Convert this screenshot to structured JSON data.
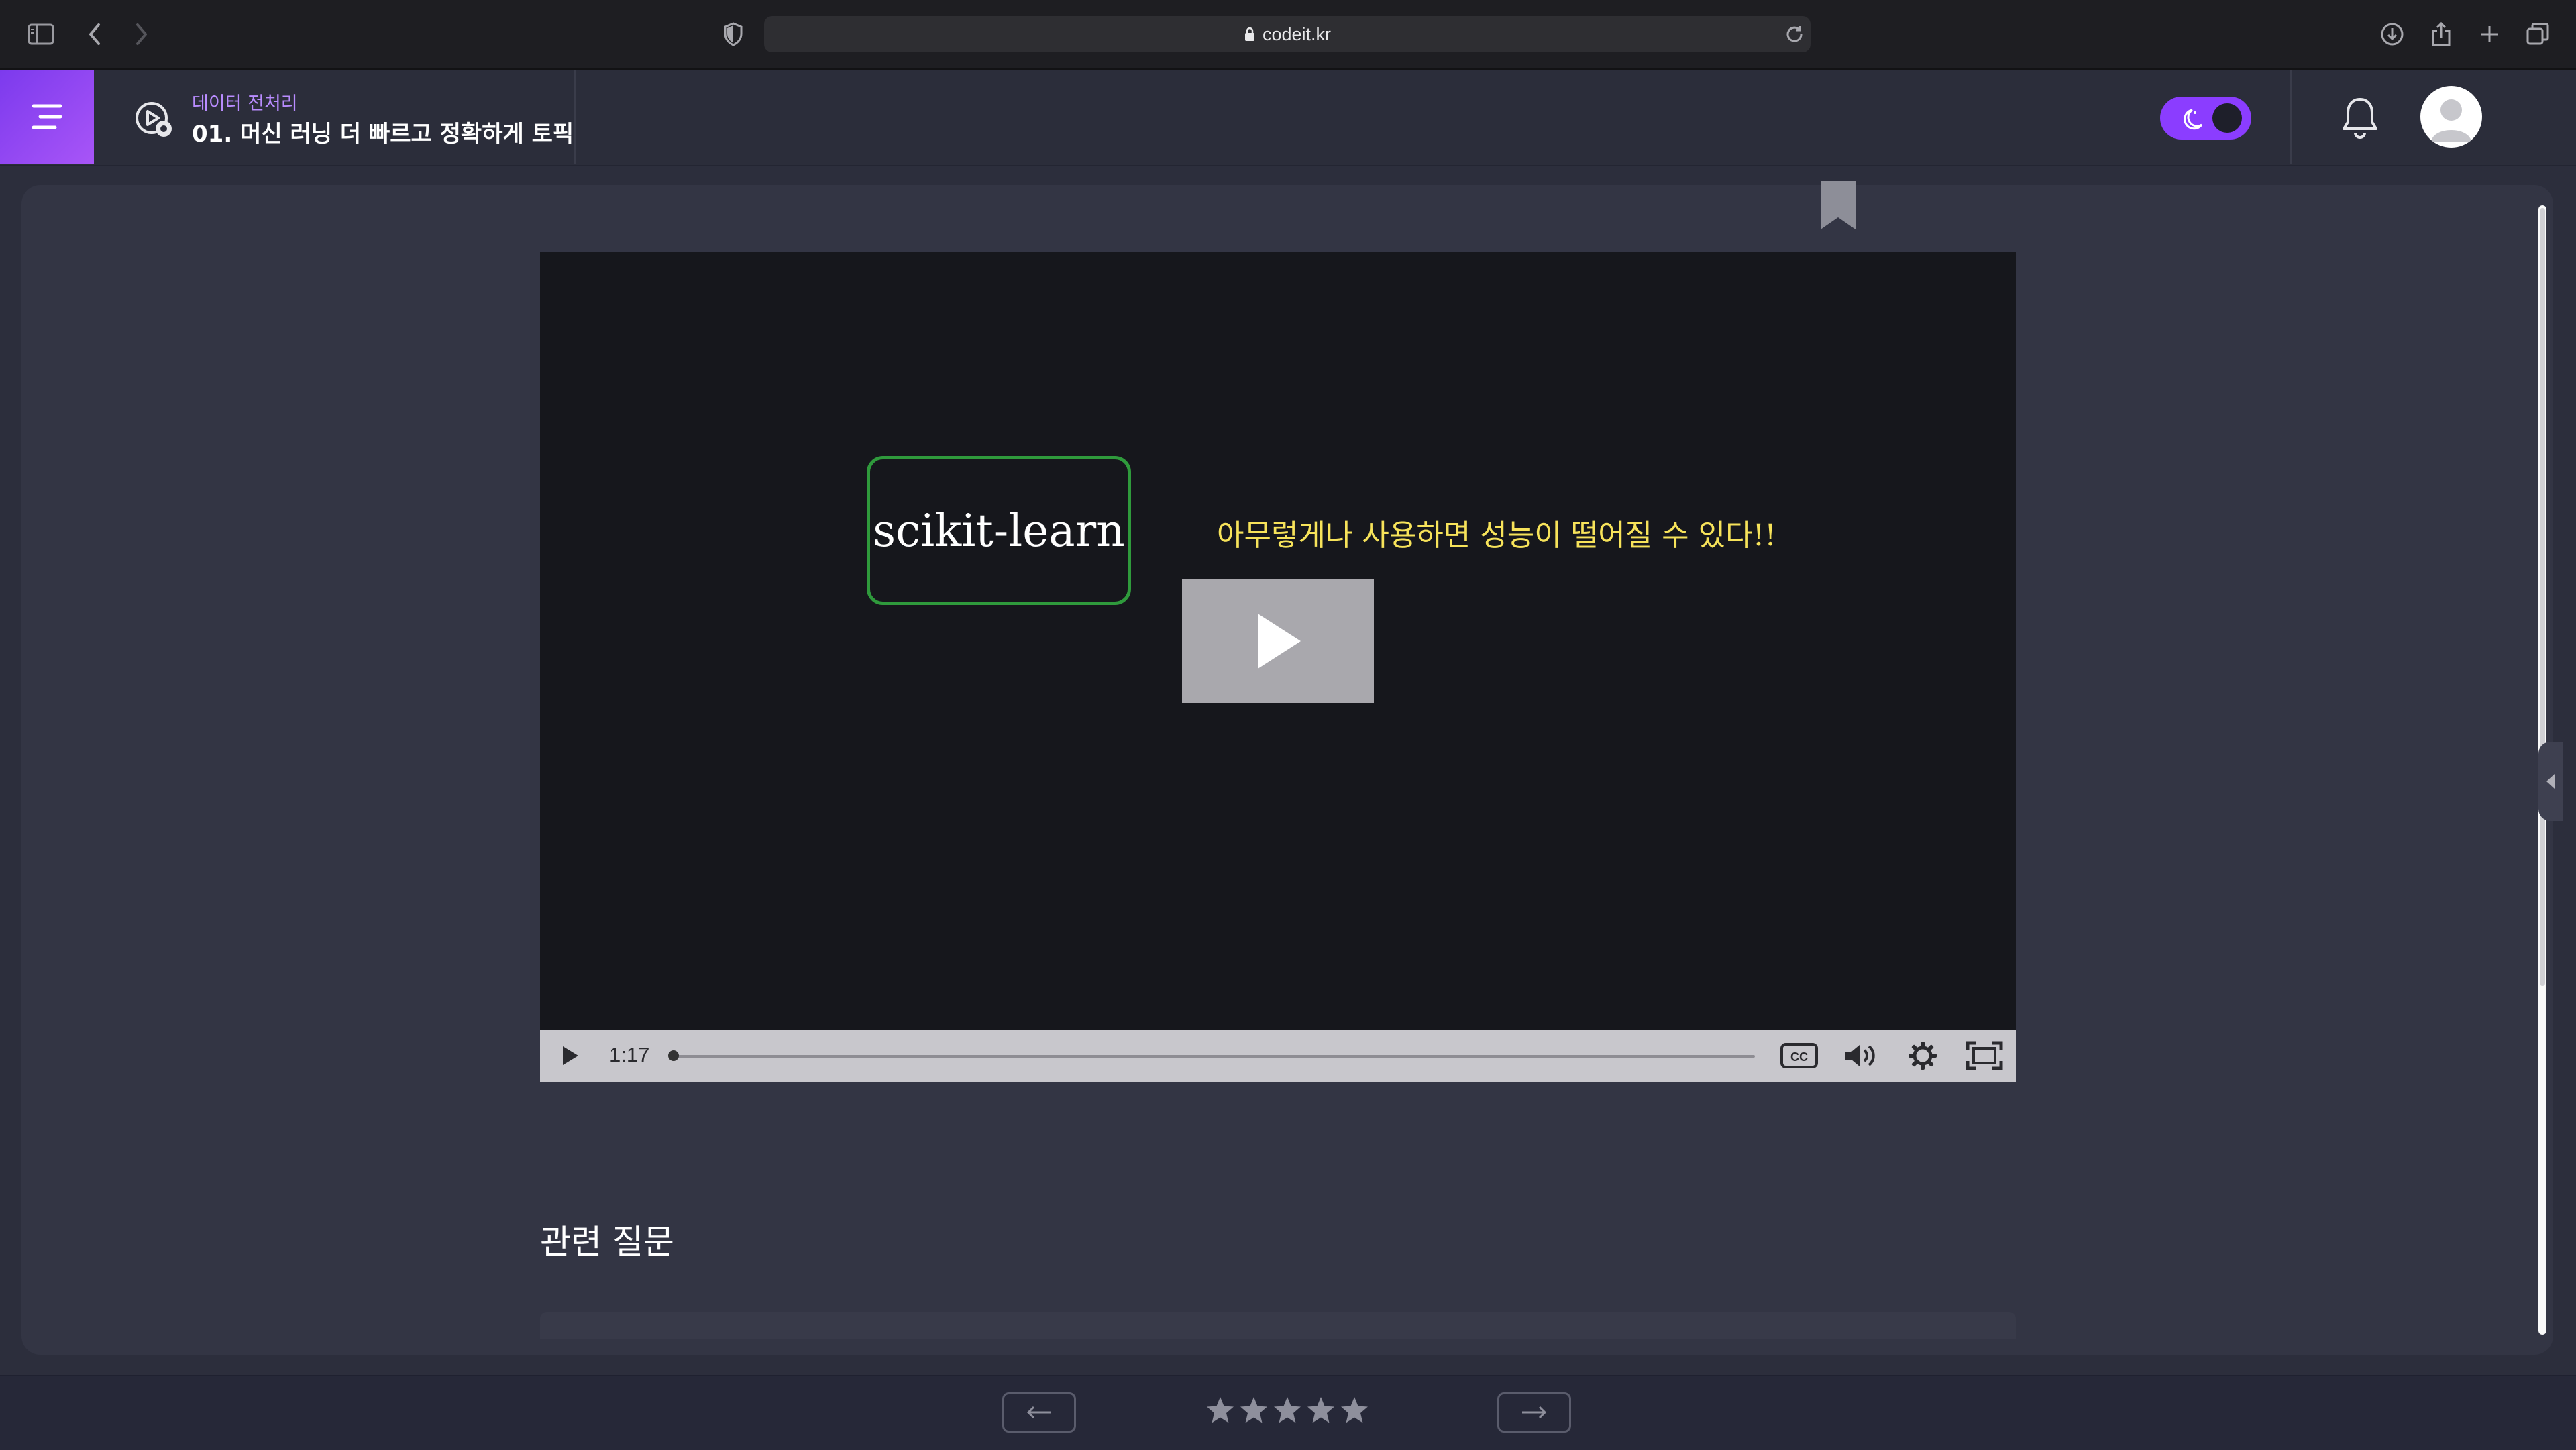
{
  "browser": {
    "url": "codeit.kr"
  },
  "header": {
    "breadcrumb": "데이터 전처리",
    "lesson_title": "01. 머신 러닝 더 빠르고 정확하게 토픽",
    "theme_toggle": "dark"
  },
  "video": {
    "slide_box_text": "scikit-learn",
    "slide_note": "아무렇게나 사용하면 성능이 떨어질 수 있다!!",
    "current_time": "1:17",
    "progress": 0.0
  },
  "related": {
    "heading": "관련 질문"
  },
  "footer": {
    "rating_stars": 5
  },
  "colors": {
    "accent": "#8b3dff",
    "background": "#2c2e3c",
    "panel": "#333544",
    "slide_box_border": "#2f9a3c",
    "slide_note_text": "#f7e35a"
  },
  "icons": {
    "sidebar": "sidebar-toggle-icon",
    "back": "chevron-left-icon",
    "forward": "chevron-right-icon",
    "privacy": "shield-icon",
    "lock": "lock-icon",
    "reload": "reload-icon",
    "download": "download-icon",
    "share": "share-icon",
    "new_tab": "plus-icon",
    "tabs": "tabs-icon",
    "menu": "menu-icon",
    "lesson": "video-lesson-icon",
    "notifications": "bell-icon",
    "avatar": "user-avatar-icon",
    "bookmark": "bookmark-icon",
    "play": "play-icon",
    "captions": "cc-icon",
    "volume": "volume-icon",
    "settings": "gear-icon",
    "fullscreen": "fullscreen-icon",
    "prev": "arrow-left-icon",
    "next": "arrow-right-icon",
    "star": "star-icon"
  }
}
